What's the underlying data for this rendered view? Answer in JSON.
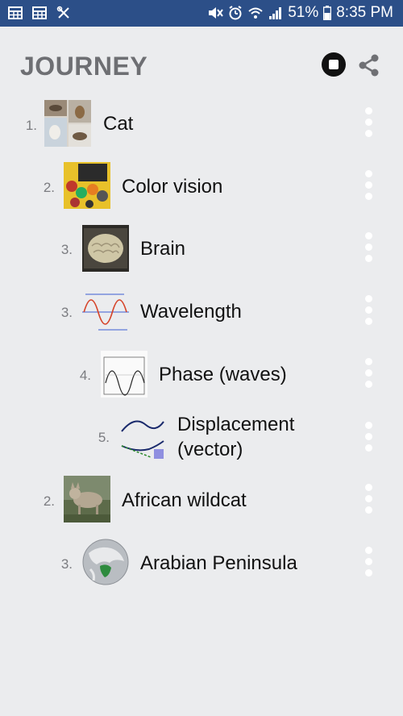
{
  "status_bar": {
    "battery": "51%",
    "time": "8:35 PM"
  },
  "header": {
    "title": "JOURNEY"
  },
  "items": [
    {
      "num": "1.",
      "label": "Cat",
      "thumb": "cat-thumbnail"
    },
    {
      "num": "2.",
      "label": "Color vision",
      "thumb": "color-vision-thumbnail"
    },
    {
      "num": "3.",
      "label": "Brain",
      "thumb": "brain-thumbnail"
    },
    {
      "num": "3.",
      "label": "Wavelength",
      "thumb": "wavelength-thumbnail"
    },
    {
      "num": "4.",
      "label": "Phase (waves)",
      "thumb": "phase-waves-thumbnail"
    },
    {
      "num": "5.",
      "label_line1": "Displacement",
      "label_line2": "(vector)",
      "thumb": "displacement-thumbnail"
    },
    {
      "num": "2.",
      "label": "African wildcat",
      "thumb": "african-wildcat-thumbnail"
    },
    {
      "num": "3.",
      "label": "Arabian Peninsula",
      "thumb": "arabian-peninsula-thumbnail"
    }
  ]
}
